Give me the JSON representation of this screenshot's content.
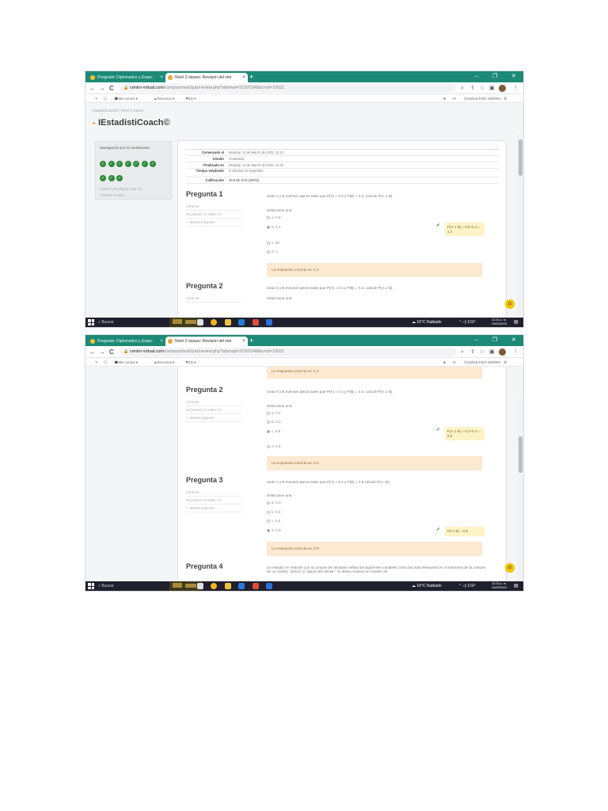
{
  "browser": {
    "tabs": [
      {
        "label": "Posgrado: Diplomados y Espec",
        "active": false
      },
      {
        "label": "Nivel 2 repaso: Revisión del inte",
        "active": true
      }
    ],
    "new_tab": "+",
    "window_controls": {
      "minimize": "–",
      "maximize": "❐",
      "close": "✕"
    },
    "nav": {
      "back": "←",
      "forward": "→",
      "reload": "C"
    },
    "url": {
      "host": "centro-virtual.com",
      "path": "/campus/mod/quiz/review.php?attempt=31920348&cmid=19531"
    },
    "right_icons": [
      "search",
      "share",
      "star",
      "sidebar"
    ]
  },
  "moodle_nav": {
    "items": [
      {
        "icon": "edit",
        "label": "✎"
      },
      {
        "icon": "screen",
        "label": "☐"
      },
      {
        "icon": "grad",
        "label": "Mis cursos  ▾"
      },
      {
        "icon": "resources",
        "label": "Recursos  ▾"
      },
      {
        "icon": "flag",
        "label": "ES  ▾"
      }
    ],
    "right": {
      "bell": "♣",
      "chat": "✉",
      "user": "CONSULTADA SIERRA",
      "settings": "⚙"
    }
  },
  "page": {
    "breadcrumb": "EstadistiCoach® / Nivel 2 repaso",
    "site_title": "IEstadistiCoach©"
  },
  "quiz_navigation": {
    "title": "Navegación por el cuestionario",
    "questions": [
      "1",
      "2",
      "3",
      "4",
      "5",
      "6",
      "7",
      "8",
      "9",
      "10"
    ],
    "show_one_page": "Mostrar una página cada vez",
    "finish_review": "Finalizar revisión"
  },
  "summary": [
    {
      "label": "Comenzado el",
      "value": "Monday, 13 de March de 2023, 11:12"
    },
    {
      "label": "Estado",
      "value": "Finalizado"
    },
    {
      "label": "Finalizado en",
      "value": "Monday, 13 de March de 2023, 11:20"
    },
    {
      "label": "Tiempo empleado",
      "value": "8 minutos 42 segundos"
    },
    {
      "label": "Calificación",
      "value": "10.0 de 10.0 (100%)"
    }
  ],
  "questions": [
    {
      "title": "Pregunta 1",
      "state": "Correcta",
      "grade": "Se puntúa 1.0 sobre 1.0",
      "flag": "⚐ Marcar pregunta",
      "text": "Sean A y B eventos ajenos tales que P(A) = 0.8 y P(B) = 0.4, calcule P(A ∪ B).",
      "prompt": "Seleccione una:",
      "options": [
        {
          "letter": "a.",
          "value": "0.6",
          "selected": false
        },
        {
          "letter": "b.",
          "value": "1.2",
          "selected": true
        },
        {
          "letter": "c.",
          "value": "00",
          "selected": false
        },
        {
          "letter": "d.",
          "value": "4",
          "selected": false
        }
      ],
      "feedback": "P(A ∪ B) = 0.8+0.4 = 1.2",
      "correct_answer": "La respuesta correcta es: 1.2"
    },
    {
      "title": "Pregunta 2",
      "state": "Correcta",
      "grade": "Se puntúa 1.0 sobre 1.0",
      "flag": "⚐ Marcar pregunta",
      "text": "Sean A y B eventos ajenos tales que P(A) = 0.2 y P(B) = 0.4, calcule P(A ∪ B).",
      "prompt": "Seleccione una:",
      "options": [
        {
          "letter": "a.",
          "value": "0.4",
          "selected": false
        },
        {
          "letter": "b.",
          "value": "0.2",
          "selected": false
        },
        {
          "letter": "c.",
          "value": "0.6",
          "selected": true
        },
        {
          "letter": "d.",
          "value": "0.5",
          "selected": false
        }
      ],
      "feedback": "P(A ∪ B) = 0.2+0.4 = 0.6",
      "correct_answer": "La respuesta correcta es: 0.6"
    },
    {
      "title": "Pregunta 3",
      "state": "Correcta",
      "grade": "Se puntúa 1.0 sobre 1.0",
      "flag": "⚐ Marcar pregunta",
      "text": "Sean A y B eventos ajenos tales que P(A) = 0.4 y P(B) = 0.9 calcule P(A∩B).",
      "prompt": "Seleccione una:",
      "options": [
        {
          "letter": "a.",
          "value": "0.3",
          "selected": false
        },
        {
          "letter": "b.",
          "value": "0.6",
          "selected": false
        },
        {
          "letter": "c.",
          "value": "0.5",
          "selected": false
        },
        {
          "letter": "d.",
          "value": "0.9",
          "selected": true
        }
      ],
      "feedback": "P(A∩B) = 0.9",
      "correct_answer": "La respuesta correcta es: 0.9"
    },
    {
      "title": "Pregunta 4",
      "text": "Un estudio en relación con la compra de celulares refleja las siguientes variables como las más relevantes en el momento de la compra de un celular: \"precio\" y \"gama del celular\". Si desea realizar un modelo de"
    }
  ],
  "prev_answer_tail": "La respuesta correcta es: 1.2",
  "taskbar": {
    "search": "Buscar",
    "weather": "16°C  Nublado",
    "tray": "^  ◁)  ESP",
    "time1": "12:22 p. m.",
    "time2": "12:23 p. m.",
    "date": "13/03/2023"
  },
  "colors": {
    "tab_bar": "#1d8a78",
    "correct_green": "#2e8b3c",
    "answer_box": "#fce9d2",
    "feedback": "#fdf3c8",
    "scroll_fab": "#f5c400",
    "taskbar": "#1f1f2e"
  }
}
